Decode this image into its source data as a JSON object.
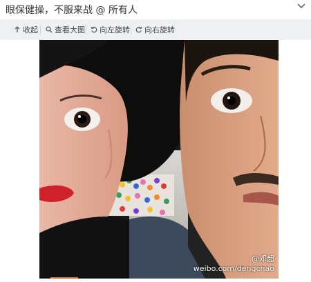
{
  "post": {
    "text": "眼保健操，不服来战",
    "mention": "@ 所有人"
  },
  "toolbar": {
    "collapse_label": "收起",
    "view_large_label": "查看大图",
    "rotate_left_label": "向左旋转",
    "rotate_right_label": "向右旋转"
  },
  "photo": {
    "watermark_line1": "@邓超",
    "watermark_line2": "weibo.com/dengchao"
  },
  "colors": {
    "toolbar_bg": "#eef0f3",
    "accent": "#e0632c"
  },
  "icons": [
    "chevron-down-icon",
    "collapse-icon",
    "search-icon",
    "rotate-left-icon",
    "rotate-right-icon"
  ]
}
